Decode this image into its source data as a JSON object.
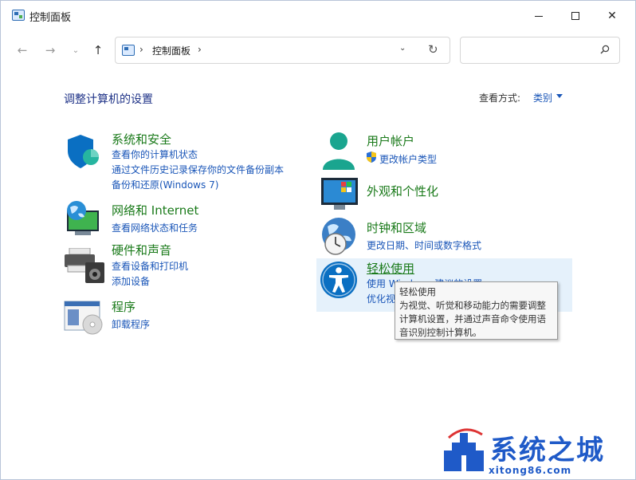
{
  "window": {
    "title": "控制面板"
  },
  "address": {
    "segment": "控制面板"
  },
  "search": {
    "placeholder": ""
  },
  "main": {
    "title": "调整计算机的设置",
    "view_by_label": "查看方式:",
    "view_by_value": "类别"
  },
  "categories": {
    "system": {
      "title": "系统和安全",
      "links": [
        "查看你的计算机状态",
        "通过文件历史记录保存你的文件备份副本",
        "备份和还原(Windows 7)"
      ]
    },
    "network": {
      "title": "网络和 Internet",
      "links": [
        "查看网络状态和任务"
      ]
    },
    "hardware": {
      "title": "硬件和声音",
      "links": [
        "查看设备和打印机",
        "添加设备"
      ]
    },
    "programs": {
      "title": "程序",
      "links": [
        "卸载程序"
      ]
    },
    "user": {
      "title": "用户帐户",
      "links": [
        "更改帐户类型"
      ]
    },
    "appearance": {
      "title": "外观和个性化"
    },
    "clock": {
      "title": "时钟和区域",
      "links": [
        "更改日期、时间或数字格式"
      ]
    },
    "ease": {
      "title": "轻松使用",
      "links": [
        "使用 Windows 建议的设置",
        "优化视"
      ]
    }
  },
  "tooltip": {
    "title": "轻松使用",
    "body": "为视觉、听觉和移动能力的需要调整计算机设置，并通过声音命令使用语音识别控制计算机。"
  },
  "watermark": {
    "text": "系统之城",
    "sub": "xitong86.com"
  },
  "colors": {
    "category_title": "#1a7a1a",
    "link": "#1a56b8",
    "page_title": "#1e3287",
    "hover": "#e5f1fb"
  }
}
